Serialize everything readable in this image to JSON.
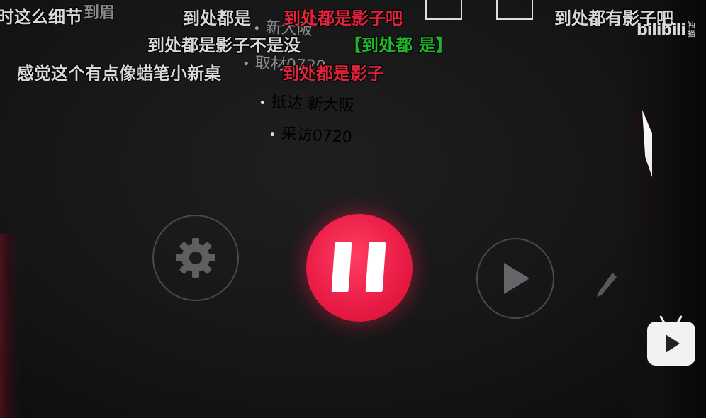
{
  "menu": {
    "items": [
      {
        "label": "新大阪"
      },
      {
        "label": "取材0720"
      },
      {
        "label": "抵达 新大阪"
      },
      {
        "label": "采访0720"
      }
    ]
  },
  "controls": {
    "settings_icon": "gear-icon",
    "pause_icon": "pause-icon",
    "play_icon": "play-icon",
    "edit_icon": "pencil-icon",
    "accent_color": "#e81b44"
  },
  "danmaku": {
    "line1": [
      "时这么细节",
      "到处都是",
      "到处都是影子吧",
      "到处都有影子吧"
    ],
    "line1b": "到眉",
    "line2": [
      "到处都是影子不是没",
      "【到处都 是】"
    ],
    "line3": [
      "感觉这个有点像蜡笔小新桌",
      "到处都是影子"
    ]
  },
  "watermark": {
    "logo": "bilibili",
    "sub": "独播"
  },
  "overlay": {
    "tv_icon": "bilibili-tv-play-icon"
  }
}
